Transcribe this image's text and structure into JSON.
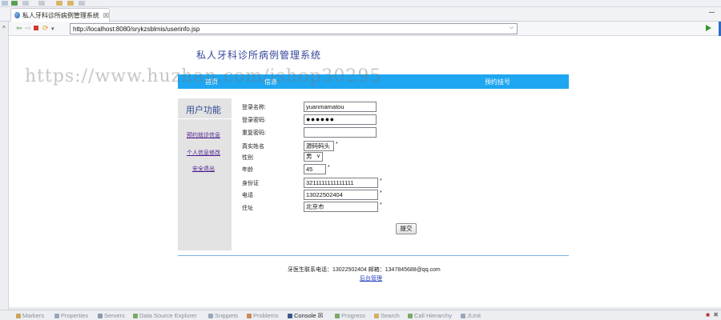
{
  "browser": {
    "tab_title": "私人牙科诊所病例管理系统",
    "tab_close": "☒",
    "url": "http://localhost:8080/srykzsblmis/userinfo.jsp"
  },
  "site": {
    "title": "私人牙科诊所病例管理系统",
    "menu": [
      "首页",
      "信息",
      "预约挂号"
    ]
  },
  "watermark": "https://www.huzhan.com/ishop30295",
  "sidebar": {
    "title": "用户功能",
    "links": [
      "预约就诊信息",
      "个人信息修改",
      "安全退出"
    ]
  },
  "form": {
    "fields": [
      {
        "label": "登录名称:",
        "value": "yuanmamatou"
      },
      {
        "label": "登录密码:",
        "value": "●●●●●●"
      },
      {
        "label": "重复密码:",
        "value": ""
      },
      {
        "label": "真实姓名",
        "value": "源码码头",
        "required": "*"
      },
      {
        "label": "性别",
        "value": "男"
      },
      {
        "label": "年龄",
        "value": "45",
        "required": "*"
      },
      {
        "label": "身份证",
        "value": "3211111111111111",
        "required": "*"
      },
      {
        "label": "电话",
        "value": "13022502404",
        "required": "*"
      },
      {
        "label": "住址",
        "value": "北京市",
        "required": "*"
      }
    ],
    "submit_label": "提交"
  },
  "footer": {
    "contact": "牙医生联系电话：13022502404 邮箱：1347845688@qq.com",
    "admin_link": "后台管理"
  },
  "bottom_panel": {
    "tabs": [
      "Markers",
      "Properties",
      "Servers",
      "Data Source Explorer",
      "Snippets",
      "Problems",
      "Console ☒",
      "Progress",
      "Search",
      "Call Hierarchy",
      "JUnit"
    ],
    "active_tab": "Console ☒"
  },
  "colors": {
    "menu_bar": "#1ea6f0",
    "title_text": "#33459a",
    "sidebar_bg": "#e3e3e3",
    "link": "#4c1d8c"
  }
}
